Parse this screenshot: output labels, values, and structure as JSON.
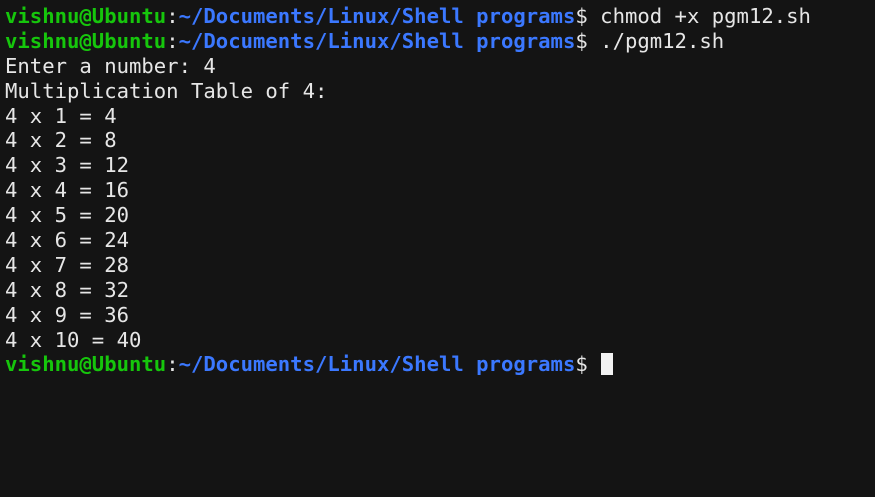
{
  "colors": {
    "background": "#141414",
    "foreground": "#e6e6e6",
    "prompt_user": "#16c60c",
    "prompt_path": "#3b78ff",
    "cursor": "#f2f2f2"
  },
  "prompt": {
    "user_host": "vishnu@Ubuntu",
    "separator": ":",
    "path": "~/Documents/Linux/Shell programs",
    "symbol": "$"
  },
  "commands": [
    " chmod +x pgm12.sh",
    " ./pgm12.sh"
  ],
  "output_lines": [
    "Enter a number: 4",
    "Multiplication Table of 4:",
    "4 x 1 = 4",
    "4 x 2 = 8",
    "4 x 3 = 12",
    "4 x 4 = 16",
    "4 x 5 = 20",
    "4 x 6 = 24",
    "4 x 7 = 28",
    "4 x 8 = 32",
    "4 x 9 = 36",
    "4 x 10 = 40"
  ]
}
